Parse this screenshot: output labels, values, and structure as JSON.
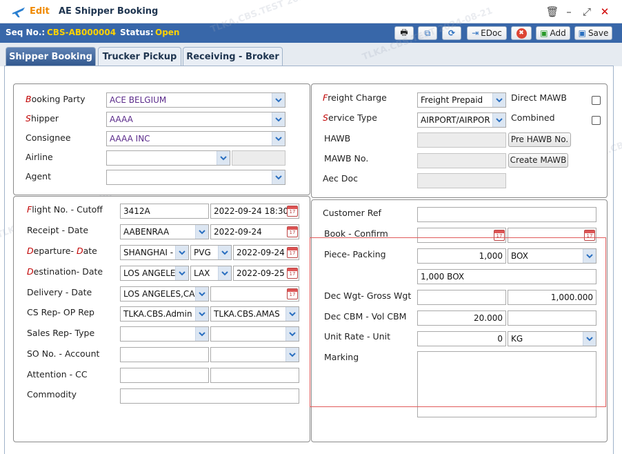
{
  "window": {
    "mode": "Edit",
    "title": "AE Shipper Booking",
    "buttons": {
      "delete": "🗑",
      "minimize": "–",
      "maximize": "⤢",
      "close": "✕"
    }
  },
  "seqbar": {
    "seq_label": "Seq No.:",
    "seq_value": "CBS-AB000004",
    "status_label": "Status:",
    "status_value": "Open"
  },
  "toolbar": {
    "print_icon": "🖶",
    "copy_icon": "⧉",
    "refresh_icon": "⟳",
    "edoc_label": "EDoc",
    "cancel_icon": "✖",
    "add_label": "Add",
    "save_label": "Save"
  },
  "tabs": [
    "Shipper Booking",
    "Trucker Pickup",
    "Receiving - Broker"
  ],
  "parties": {
    "booking_party": {
      "label_first": "B",
      "label_rest": "ooking Party",
      "value": "ACE BELGIUM"
    },
    "shipper": {
      "label_first": "S",
      "label_rest": "hipper",
      "value": "AAAA"
    },
    "consignee": {
      "label": "Consignee",
      "value": "AAAA INC"
    },
    "airline": {
      "label": "Airline",
      "value": "",
      "code": ""
    },
    "agent": {
      "label": "Agent",
      "value": ""
    }
  },
  "routing": {
    "flight": {
      "label_first": "F",
      "label_rest": "light No. - Cutoff",
      "value": "3412A",
      "cutoff": "2022-09-24 18:30"
    },
    "receipt": {
      "label": "Receipt - Date",
      "value": "AABENRAA",
      "date": "2022-09-24"
    },
    "departure": {
      "label_a": "D",
      "label_b": "eparture- ",
      "label_c": "D",
      "label_d": "ate",
      "value": "SHANGHAI - ",
      "code": "PVG",
      "date": "2022-09-24 18:"
    },
    "destination": {
      "label_a": "D",
      "label_b": "estination- Date",
      "value": "LOS ANGELES",
      "code": "LAX",
      "date": "2022-09-25 00:"
    },
    "delivery": {
      "label": "Delivery - Date",
      "value": "LOS ANGELES,CA",
      "date": ""
    },
    "cs_rep": {
      "label": "CS Rep- OP Rep",
      "cs": "TLKA.CBS.Admin",
      "op": "TLKA.CBS.AMAS"
    },
    "sales_rep": {
      "label": "Sales Rep- Type",
      "rep": "",
      "type": ""
    },
    "so_no": {
      "label": "SO No. - Account",
      "so": "",
      "account": ""
    },
    "attention": {
      "label": "Attention - CC",
      "attention": "",
      "cc": ""
    },
    "commodity": {
      "label": "Commodity",
      "value": ""
    }
  },
  "freight": {
    "freight_charge": {
      "label_first": "F",
      "label_rest": "reight Charge",
      "value": "Freight Prepaid"
    },
    "service_type": {
      "label_first": "S",
      "label_rest": "ervice Type",
      "value": "AIRPORT/AIRPOR"
    },
    "direct_mawb": {
      "label": "Direct MAWB",
      "checked": false
    },
    "combined": {
      "label": "Combined",
      "checked": false
    },
    "hawb": {
      "label": "HAWB",
      "value": "",
      "button": "Pre HAWB No."
    },
    "mawb": {
      "label": "MAWB No.",
      "value": "",
      "button": "Create MAWB"
    },
    "aec_doc": {
      "label": "Aec Doc",
      "value": ""
    }
  },
  "cargo": {
    "customer_ref": {
      "label": "Customer Ref",
      "value": ""
    },
    "book_confirm": {
      "label": "Book - Confirm",
      "book": "",
      "confirm": ""
    },
    "piece_packing": {
      "label": "Piece- Packing",
      "piece": "1,000",
      "packing": "BOX",
      "summary": "1,000 BOX"
    },
    "weight": {
      "label": "Dec Wgt- Gross Wgt",
      "dec": "",
      "gross": "1,000.000"
    },
    "cbm": {
      "label": "Dec CBM - Vol CBM",
      "dec": "20.000",
      "vol": ""
    },
    "unit_rate": {
      "label": "Unit Rate - Unit",
      "rate": "0",
      "unit": "KG"
    },
    "marking": {
      "label": "Marking",
      "value": ""
    }
  },
  "watermark": [
    "TLKA.CBS.TEST 2024-08-21"
  ],
  "colors": {
    "accent": "#3867a9",
    "seq_value": "#ffd200",
    "edit": "#f08a00",
    "required": "#c00000"
  }
}
